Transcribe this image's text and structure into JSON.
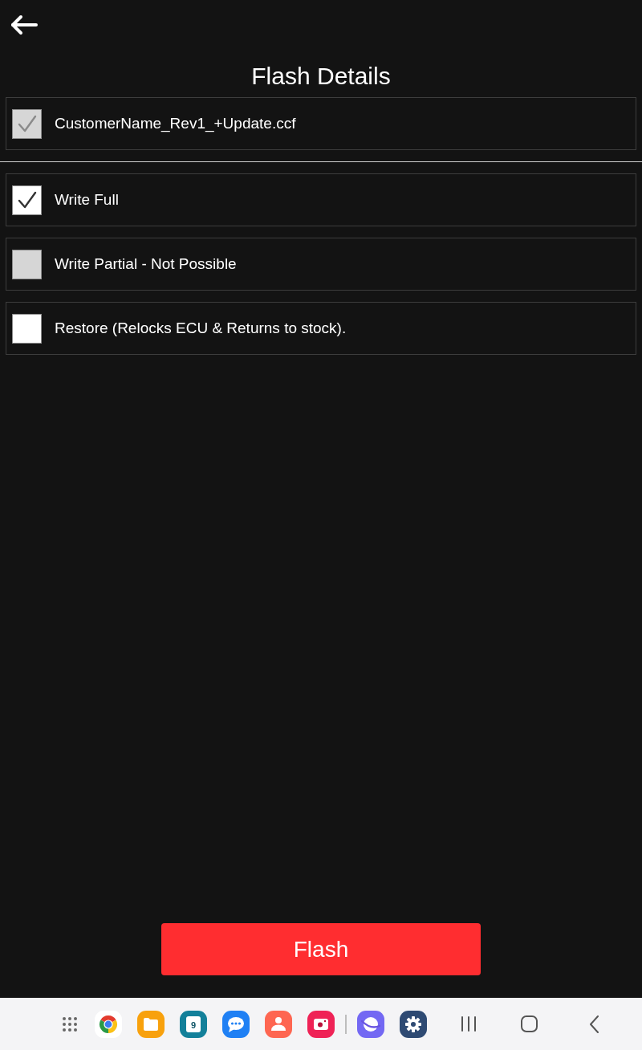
{
  "title": "Flash Details",
  "file": {
    "label": "CustomerName_Rev1_+Update.ccf",
    "checked": true,
    "disabled": true
  },
  "options": [
    {
      "label": "Write Full",
      "checked": true,
      "disabled": false
    },
    {
      "label": "Write Partial - Not Possible",
      "checked": false,
      "disabled": true
    },
    {
      "label": "Restore (Relocks ECU & Returns to stock).",
      "checked": false,
      "disabled": false
    }
  ],
  "action_button": "Flash",
  "taskbar": {
    "calendar_day": "9"
  }
}
